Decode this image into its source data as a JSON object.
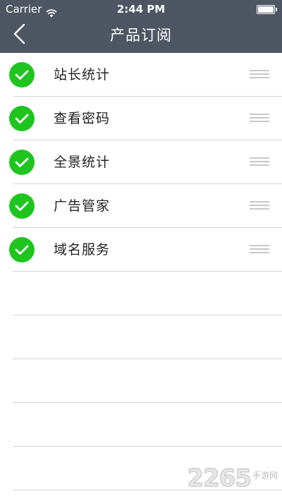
{
  "status_bar": {
    "carrier": "Carrier",
    "time": "2:44 PM",
    "wifi_icon": "wifi-icon",
    "battery_icon": "battery-full-icon"
  },
  "nav": {
    "title": "产品订阅",
    "back_icon": "chevron-left-icon"
  },
  "subscriptions": [
    {
      "label": "站长统计",
      "checked": true
    },
    {
      "label": "查看密码",
      "checked": true
    },
    {
      "label": "全景统计",
      "checked": true
    },
    {
      "label": "广告管家",
      "checked": true
    },
    {
      "label": "域名服务",
      "checked": true
    }
  ],
  "watermark": {
    "number": "2265",
    "text": "手游网"
  },
  "colors": {
    "nav_background": "#4f5663",
    "check_green": "#1ec51e",
    "separator": "#d6d6d6"
  }
}
